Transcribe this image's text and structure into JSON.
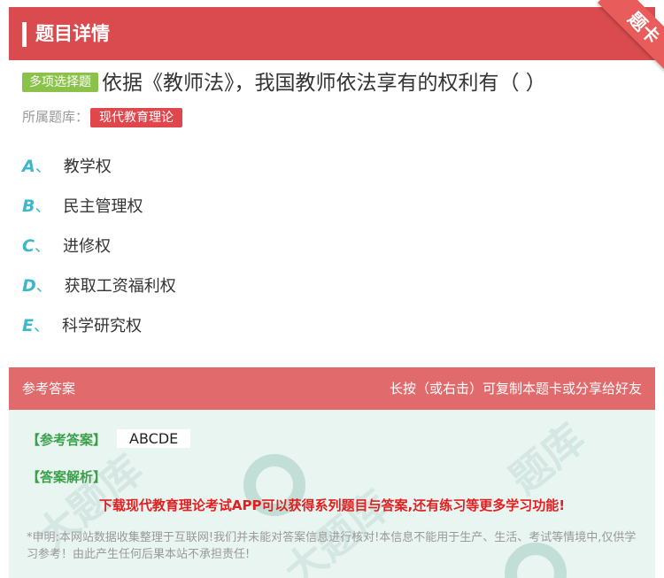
{
  "header": {
    "title": "题目详情"
  },
  "ribbon": {
    "label": "题卡"
  },
  "question": {
    "type_tag": "多项选择题",
    "text": "依据《教师法》，我国教师依法享有的权利有（ ）",
    "bank_label": "所属题库：",
    "bank_name": "现代教育理论"
  },
  "options": [
    {
      "letter": "A",
      "sep": "、",
      "text": "教学权"
    },
    {
      "letter": "B",
      "sep": "、",
      "text": "民主管理权"
    },
    {
      "letter": "C",
      "sep": "、",
      "text": "进修权"
    },
    {
      "letter": "D",
      "sep": "、",
      "text": "获取工资福利权"
    },
    {
      "letter": "E",
      "sep": "、",
      "text": "科学研究权"
    }
  ],
  "answer": {
    "head_left": "参考答案",
    "head_right": "长按（或右击）可复制本题卡或分享给好友",
    "ref_label": "【参考答案】",
    "ref_value": "ABCDE",
    "analysis_label": "【答案解析】",
    "promo": "下载现代教育理论考试APP可以获得系列题目与答案,还有练习等更多学习功能!",
    "disclaimer": "*申明:本网站数据收集整理于互联网!我们并未能对答案信息进行核对!本信息不能用于生产、生活、考试等情境中,仅供学习参考！由此产生任何后果本站不承担责任!"
  },
  "colors": {
    "header_bg": "#d94b4f",
    "option_letter": "#3eb8c9",
    "type_tag_bg": "#8bc34a",
    "answer_label": "#3aa14a",
    "promo": "#e02020"
  }
}
